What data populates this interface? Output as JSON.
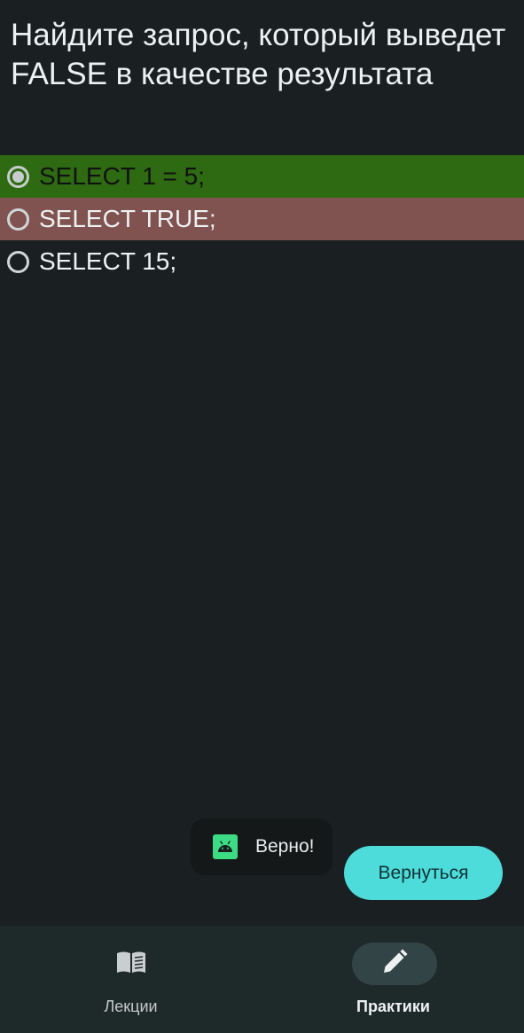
{
  "question": {
    "text": "Найдите запрос, который выведет FALSE в качестве результата"
  },
  "options": [
    {
      "label": "SELECT 1 = 5;",
      "state": "correct",
      "selected": true
    },
    {
      "label": "SELECT TRUE;",
      "state": "wrong",
      "selected": false
    },
    {
      "label": "SELECT 15;",
      "state": "neutral",
      "selected": false
    }
  ],
  "toast": {
    "icon": "android-icon",
    "text": "Верно!"
  },
  "back_button": {
    "label": "Вернуться"
  },
  "bottom_nav": {
    "items": [
      {
        "label": "Лекции",
        "icon": "book-icon",
        "active": false
      },
      {
        "label": "Практики",
        "icon": "pencil-icon",
        "active": true
      }
    ]
  },
  "colors": {
    "background": "#1a1f21",
    "correct": "#2e6a12",
    "wrong": "#805350",
    "accent": "#4ddcda",
    "nav_background": "#1e292a"
  }
}
